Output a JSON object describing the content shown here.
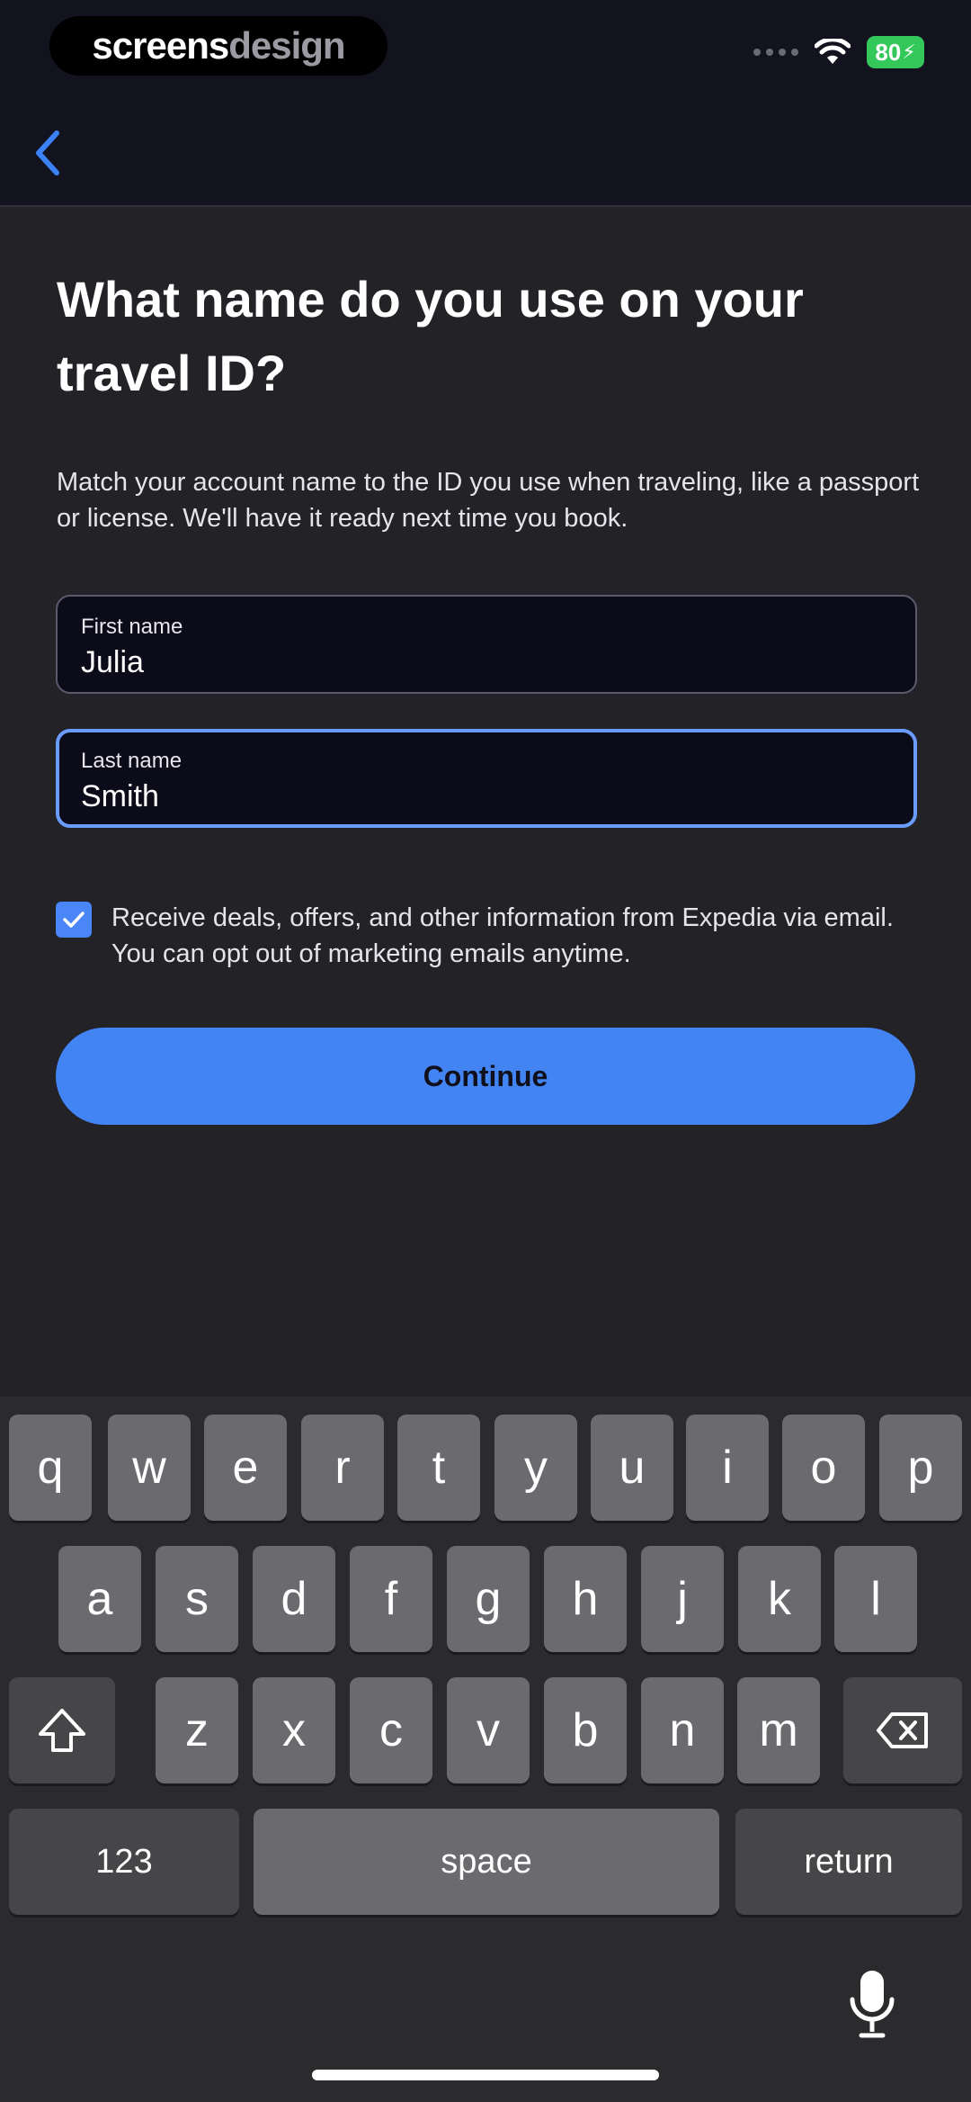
{
  "brand": {
    "part1": "screens",
    "part2": "design"
  },
  "status_bar": {
    "battery": "80"
  },
  "header": {
    "title": "What name do you use on your travel ID?"
  },
  "subtitle": "Match your account name to the ID you use when traveling, like a passport or license. We'll have it ready next time you book.",
  "form": {
    "first_name": {
      "label": "First name",
      "value": "Julia"
    },
    "last_name": {
      "label": "Last name",
      "value": "Smith"
    }
  },
  "consent": {
    "checked": true,
    "text": "Receive deals, offers, and other information from Expedia via email. You can opt out of marketing emails anytime."
  },
  "continue_label": "Continue",
  "keyboard": {
    "row1": [
      "q",
      "w",
      "e",
      "r",
      "t",
      "y",
      "u",
      "i",
      "o",
      "p"
    ],
    "row2": [
      "a",
      "s",
      "d",
      "f",
      "g",
      "h",
      "j",
      "k",
      "l"
    ],
    "row3": [
      "z",
      "x",
      "c",
      "v",
      "b",
      "n",
      "m"
    ],
    "numbers_label": "123",
    "space_label": "space",
    "return_label": "return"
  },
  "colors": {
    "accent": "#4384f3",
    "background": "#232227",
    "header": "#13131f",
    "focus_border": "#6a9bff"
  }
}
